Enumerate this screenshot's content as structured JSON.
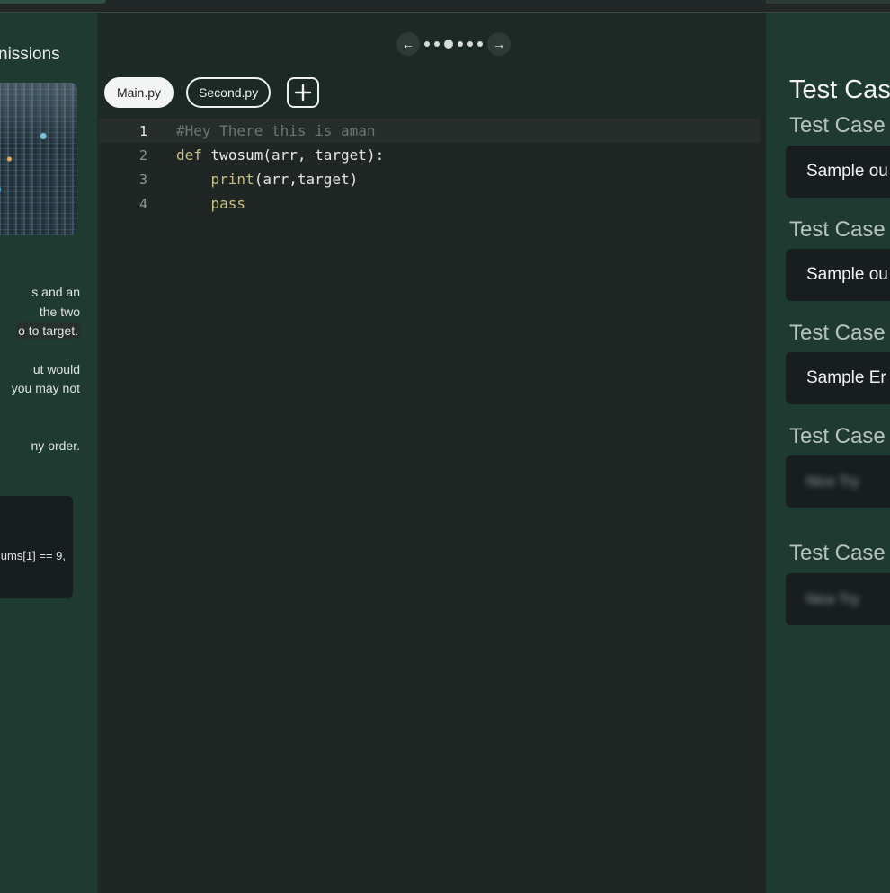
{
  "problem": {
    "tab_title": "nissions",
    "description": [
      "s and an",
      "the two",
      "o to target.",
      "",
      "ut would",
      "you may not",
      "",
      "",
      "ny order."
    ],
    "example_text": "ums[1] == 9,"
  },
  "editor": {
    "pager": {
      "prev": "←",
      "next": "→",
      "dots": 6,
      "active_dot": 3
    },
    "tabs": [
      {
        "label": "Main.py",
        "active": true
      },
      {
        "label": "Second.py",
        "active": false
      }
    ],
    "add_label": "+",
    "lines": [
      {
        "n": "1",
        "text": "#Hey There this is aman"
      },
      {
        "n": "2",
        "text": "def twosum(arr, target):"
      },
      {
        "n": "3",
        "text": "    print(arr,target)"
      },
      {
        "n": "4",
        "text": "    pass"
      }
    ]
  },
  "test_cases": {
    "heading": "Test Cas",
    "items": [
      {
        "label": "Test Case",
        "value": "Sample ou"
      },
      {
        "label": "Test Case",
        "value": "Sample ou"
      },
      {
        "label": "Test Case",
        "value": "Sample Er"
      },
      {
        "label": "Test Case",
        "value": "Nice Try"
      },
      {
        "label": "Test Case",
        "value": "Nice Try"
      }
    ]
  },
  "colors": {
    "panel_bg": "#1f3a31",
    "editor_bg": "#202624",
    "keyword": "#c5bf83",
    "comment": "#6e7471"
  }
}
